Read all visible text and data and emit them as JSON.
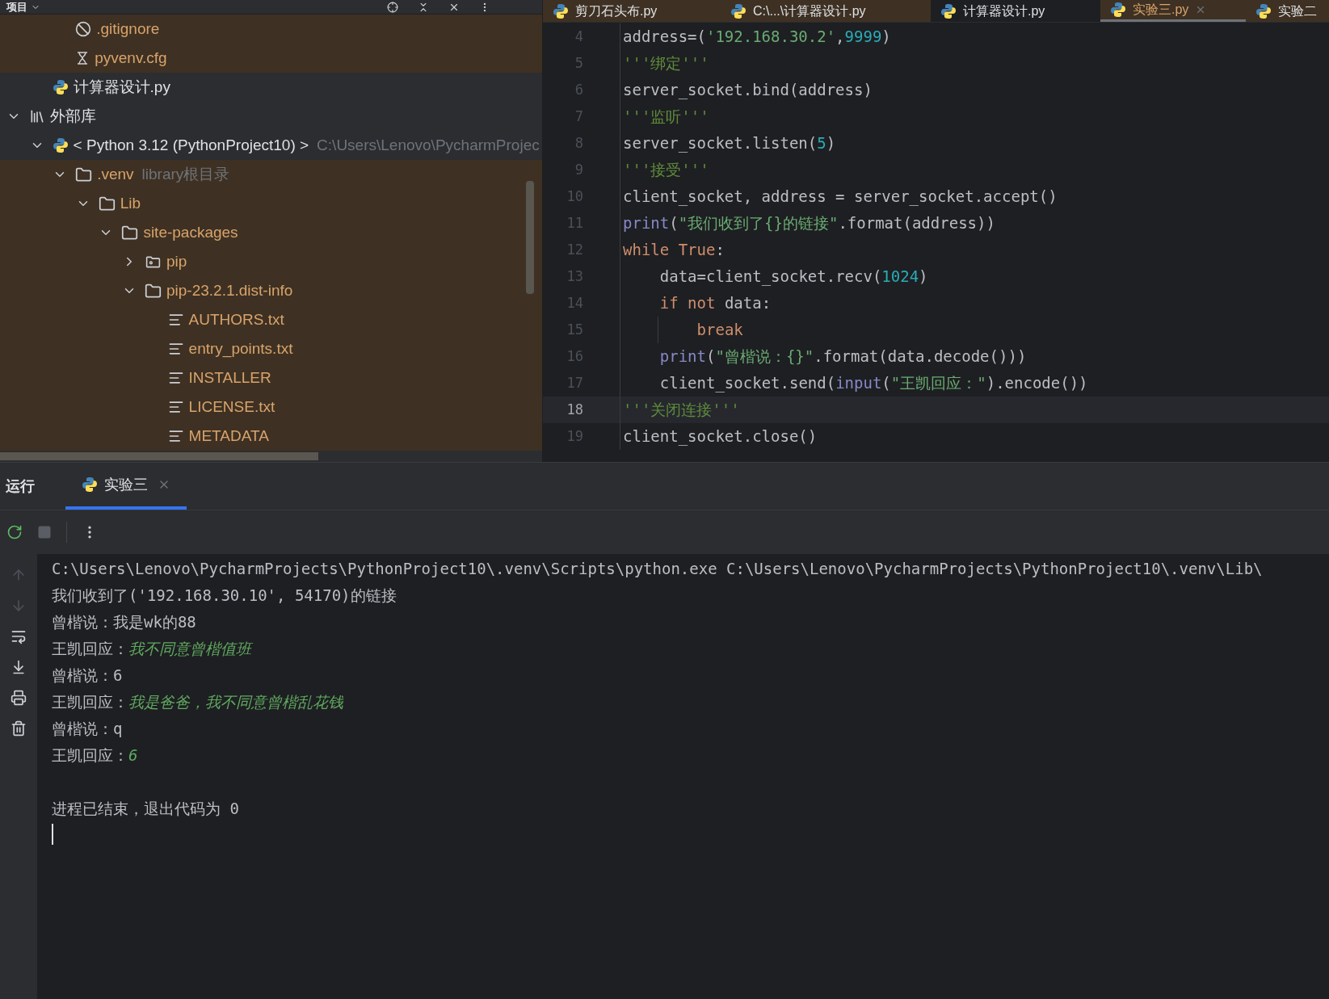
{
  "project_panel": {
    "title": "项目",
    "tree": [
      {
        "children": [
          {
            "children": [
              {
                "label": ".gitignore",
                "kind": "ignore",
                "highlighted": true
              },
              {
                "label": "pyvenv.cfg",
                "kind": "config",
                "highlighted": true
              }
            ]
          },
          {
            "label": "计算器设计.py",
            "kind": "python",
            "highlighted": false
          }
        ]
      },
      {
        "label": "外部库",
        "kind": "library",
        "highlighted": false,
        "expanded": true,
        "children": [
          {
            "label": "< Python 3.12 (PythonProject10) >",
            "hint": "C:\\Users\\Lenovo\\PycharmProjec",
            "kind": "python",
            "highlighted": false,
            "expanded": true,
            "children": [
              {
                "label": ".venv",
                "hint": "library根目录",
                "kind": "folder",
                "highlighted": true,
                "expanded": true,
                "children": [
                  {
                    "label": "Lib",
                    "kind": "folder",
                    "highlighted": true,
                    "expanded": true,
                    "children": [
                      {
                        "label": "site-packages",
                        "kind": "folder",
                        "highlighted": true,
                        "expanded": true,
                        "children": [
                          {
                            "label": "pip",
                            "kind": "package",
                            "highlighted": true,
                            "expanded": false
                          },
                          {
                            "label": "pip-23.2.1.dist-info",
                            "kind": "folder",
                            "highlighted": true,
                            "expanded": true,
                            "children": [
                              {
                                "label": "AUTHORS.txt",
                                "kind": "text",
                                "highlighted": true
                              },
                              {
                                "label": "entry_points.txt",
                                "kind": "text",
                                "highlighted": true
                              },
                              {
                                "label": "INSTALLER",
                                "kind": "text",
                                "highlighted": true
                              },
                              {
                                "label": "LICENSE.txt",
                                "kind": "text",
                                "highlighted": true
                              },
                              {
                                "label": "METADATA",
                                "kind": "text",
                                "highlighted": true
                              }
                            ]
                          }
                        ]
                      }
                    ]
                  }
                ]
              }
            ]
          }
        ]
      }
    ]
  },
  "editor": {
    "tabs": [
      {
        "label": "剪刀石头布.py",
        "selected": false,
        "highlighted": true
      },
      {
        "label": "C:\\...\\计算器设计.py",
        "selected": false,
        "highlighted": true
      },
      {
        "label": "计算器设计.py",
        "selected": false,
        "highlighted": false
      },
      {
        "label": "实验三.py",
        "selected": true,
        "highlighted": true
      },
      {
        "label": "实验二",
        "selected": false,
        "highlighted": true
      }
    ],
    "lines": [
      {
        "number": "4",
        "current": false,
        "tokens": [
          {
            "text": "address=(",
            "kind": "plain"
          },
          {
            "text": "'192.168.30.2'",
            "kind": "str"
          },
          {
            "text": ",",
            "kind": "plain"
          },
          {
            "text": "9999",
            "kind": "num"
          },
          {
            "text": ")",
            "kind": "plain"
          }
        ]
      },
      {
        "number": "5",
        "current": false,
        "tokens": [
          {
            "text": "'''绑定'''",
            "kind": "doc"
          }
        ]
      },
      {
        "number": "6",
        "current": false,
        "tokens": [
          {
            "text": "server_socket.bind(address)",
            "kind": "plain"
          }
        ]
      },
      {
        "number": "7",
        "current": false,
        "tokens": [
          {
            "text": "'''监听'''",
            "kind": "doc"
          }
        ]
      },
      {
        "number": "8",
        "current": false,
        "tokens": [
          {
            "text": "server_socket.listen(",
            "kind": "plain"
          },
          {
            "text": "5",
            "kind": "num"
          },
          {
            "text": ")",
            "kind": "plain"
          }
        ]
      },
      {
        "number": "9",
        "current": false,
        "tokens": [
          {
            "text": "'''接受'''",
            "kind": "doc"
          }
        ]
      },
      {
        "number": "10",
        "current": false,
        "tokens": [
          {
            "text": "client_socket, address = server_socket.accept()",
            "kind": "plain"
          }
        ]
      },
      {
        "number": "11",
        "current": false,
        "tokens": [
          {
            "text": "print",
            "kind": "builtin"
          },
          {
            "text": "(",
            "kind": "plain"
          },
          {
            "text": "\"我们收到了{}的链接\"",
            "kind": "str"
          },
          {
            "text": ".format(address))",
            "kind": "plain"
          }
        ]
      },
      {
        "number": "12",
        "current": false,
        "tokens": [
          {
            "text": "while True",
            "kind": "kw"
          },
          {
            "text": ":",
            "kind": "plain"
          }
        ],
        "children": [
          {
            "number": "13",
            "current": false,
            "tokens": [
              {
                "text": "data=client_socket.recv(",
                "kind": "plain"
              },
              {
                "text": "1024",
                "kind": "num"
              },
              {
                "text": ")",
                "kind": "plain"
              }
            ]
          },
          {
            "number": "14",
            "current": false,
            "tokens": [
              {
                "text": "if not",
                "kind": "kw"
              },
              {
                "text": " data:",
                "kind": "plain"
              }
            ],
            "children": [
              {
                "number": "15",
                "current": false,
                "tokens": [
                  {
                    "text": "break",
                    "kind": "kw"
                  }
                ]
              }
            ]
          },
          {
            "number": "16",
            "current": false,
            "tokens": [
              {
                "text": "print",
                "kind": "builtin"
              },
              {
                "text": "(",
                "kind": "plain"
              },
              {
                "text": "\"曾楷说：{}\"",
                "kind": "str"
              },
              {
                "text": ".format(data.decode()))",
                "kind": "plain"
              }
            ]
          },
          {
            "number": "17",
            "current": false,
            "tokens": [
              {
                "text": "client_socket.send(",
                "kind": "plain"
              },
              {
                "text": "input",
                "kind": "builtin"
              },
              {
                "text": "(",
                "kind": "plain"
              },
              {
                "text": "\"王凯回应：\"",
                "kind": "str"
              },
              {
                "text": ").encode())",
                "kind": "plain"
              }
            ]
          }
        ]
      },
      {
        "number": "18",
        "current": true,
        "tokens": [
          {
            "text": "'''关闭连接'''",
            "kind": "doc"
          }
        ]
      },
      {
        "number": "19",
        "current": false,
        "tokens": [
          {
            "text": "client_socket.close()",
            "kind": "plain"
          }
        ]
      }
    ]
  },
  "run_panel": {
    "title": "运行",
    "tabs": [
      {
        "label": "实验三",
        "selected": true
      }
    ],
    "console": [
      [
        {
          "text": "C:\\Users\\Lenovo\\PycharmProjects\\PythonProject10\\.venv\\Scripts\\python.exe C:\\Users\\Lenovo\\PycharmProjects\\PythonProject10\\.venv\\Lib\\",
          "kind": "output"
        }
      ],
      [
        {
          "text": "我们收到了('192.168.30.10', 54170)的链接",
          "kind": "output"
        }
      ],
      [
        {
          "text": "曾楷说：我是wk的88",
          "kind": "output"
        }
      ],
      [
        {
          "text": "王凯回应：",
          "kind": "output"
        },
        {
          "text": "我不同意曾楷值班",
          "kind": "input"
        }
      ],
      [
        {
          "text": "曾楷说：6",
          "kind": "output"
        }
      ],
      [
        {
          "text": "王凯回应：",
          "kind": "output"
        },
        {
          "text": "我是爸爸，我不同意曾楷乱花钱",
          "kind": "input"
        }
      ],
      [
        {
          "text": "曾楷说：q",
          "kind": "output"
        }
      ],
      [
        {
          "text": "王凯回应：",
          "kind": "output"
        },
        {
          "text": "6",
          "kind": "input"
        }
      ],
      [
        {
          "text": "进程已结束，退出代码为 0",
          "kind": "exit"
        }
      ]
    ]
  }
}
